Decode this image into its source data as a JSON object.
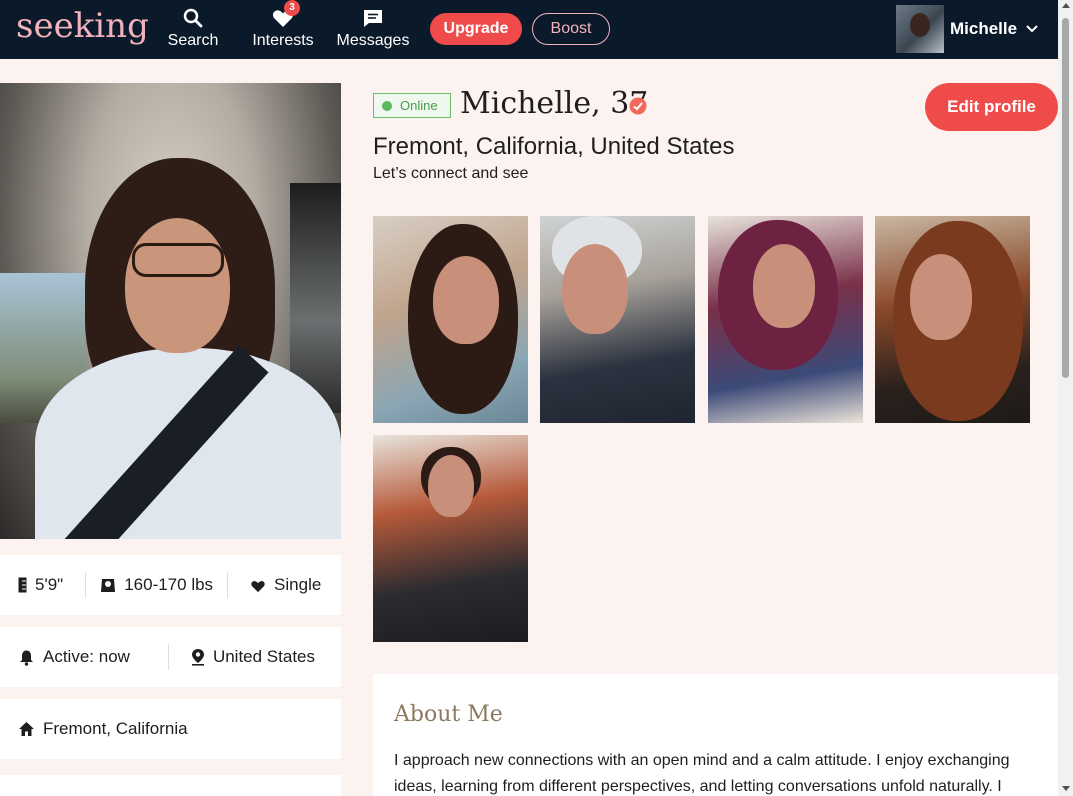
{
  "nav": {
    "logo": "seeking",
    "items": [
      {
        "label": "Search",
        "icon": "search-icon"
      },
      {
        "label": "Interests",
        "icon": "heart-icon",
        "badge": "3"
      },
      {
        "label": "Messages",
        "icon": "chat-icon"
      }
    ],
    "upgrade_label": "Upgrade",
    "boost_label": "Boost",
    "user_name": "Michelle"
  },
  "profile": {
    "online_label": "Online",
    "name_age": "Michelle, 37",
    "location": "Fremont, California, United States",
    "tagline": "Let’s connect and see",
    "edit_label": "Edit profile"
  },
  "stats": {
    "height": "5'9\"",
    "weight": "160-170 lbs",
    "status": "Single",
    "active": "Active: now",
    "country": "United States",
    "city": "Fremont, California"
  },
  "about": {
    "title": "About Me",
    "text": "I approach new connections with an open mind and a calm attitude. I enjoy exchanging ideas, learning from different perspectives, and letting conversations unfold naturally. I"
  },
  "colors": {
    "nav_bg": "#0b1a2a",
    "accent": "#f04b4b",
    "logo_pink": "#f2b2bb",
    "page_bg": "#fcf3f1",
    "online_green": "#5cb85c"
  }
}
